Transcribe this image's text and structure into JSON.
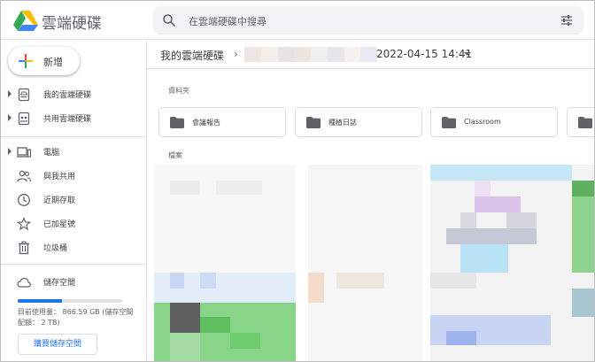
{
  "header": {
    "app_title": "雲端硬碟",
    "search_placeholder": "在雲端硬碟中搜尋"
  },
  "sidebar": {
    "new_label": "新增",
    "items": [
      {
        "label": "我的雲端硬碟",
        "icon": "my-drive-icon"
      },
      {
        "label": "共用雲端硬碟",
        "icon": "shared-drives-icon"
      },
      {
        "label": "電腦",
        "icon": "computers-icon"
      },
      {
        "label": "與我共用",
        "icon": "shared-with-me-icon"
      },
      {
        "label": "近期存取",
        "icon": "recent-icon"
      },
      {
        "label": "已加星號",
        "icon": "starred-icon"
      },
      {
        "label": "垃圾桶",
        "icon": "trash-icon"
      },
      {
        "label": "儲存空間",
        "icon": "cloud-icon"
      }
    ],
    "storage": {
      "usage_text": "目前使用量： 866.59 GB (儲存空間配額： 2 TB)",
      "used_fraction": 0.42,
      "buy_label": "購買儲存空間"
    }
  },
  "main": {
    "breadcrumb_root": "我的雲端硬碟",
    "breadcrumb_sep": "›",
    "current_folder": "2022-04-15 14:41",
    "folders_label": "資料夾",
    "files_label": "檔案",
    "folders": [
      {
        "name": "會議報告"
      },
      {
        "name": "種植日誌"
      },
      {
        "name": "Classroom"
      }
    ]
  },
  "colors": {
    "accent_blue": "#1a73e8",
    "divider": "#e0e0e0",
    "search_bg": "#f1f3f4"
  }
}
